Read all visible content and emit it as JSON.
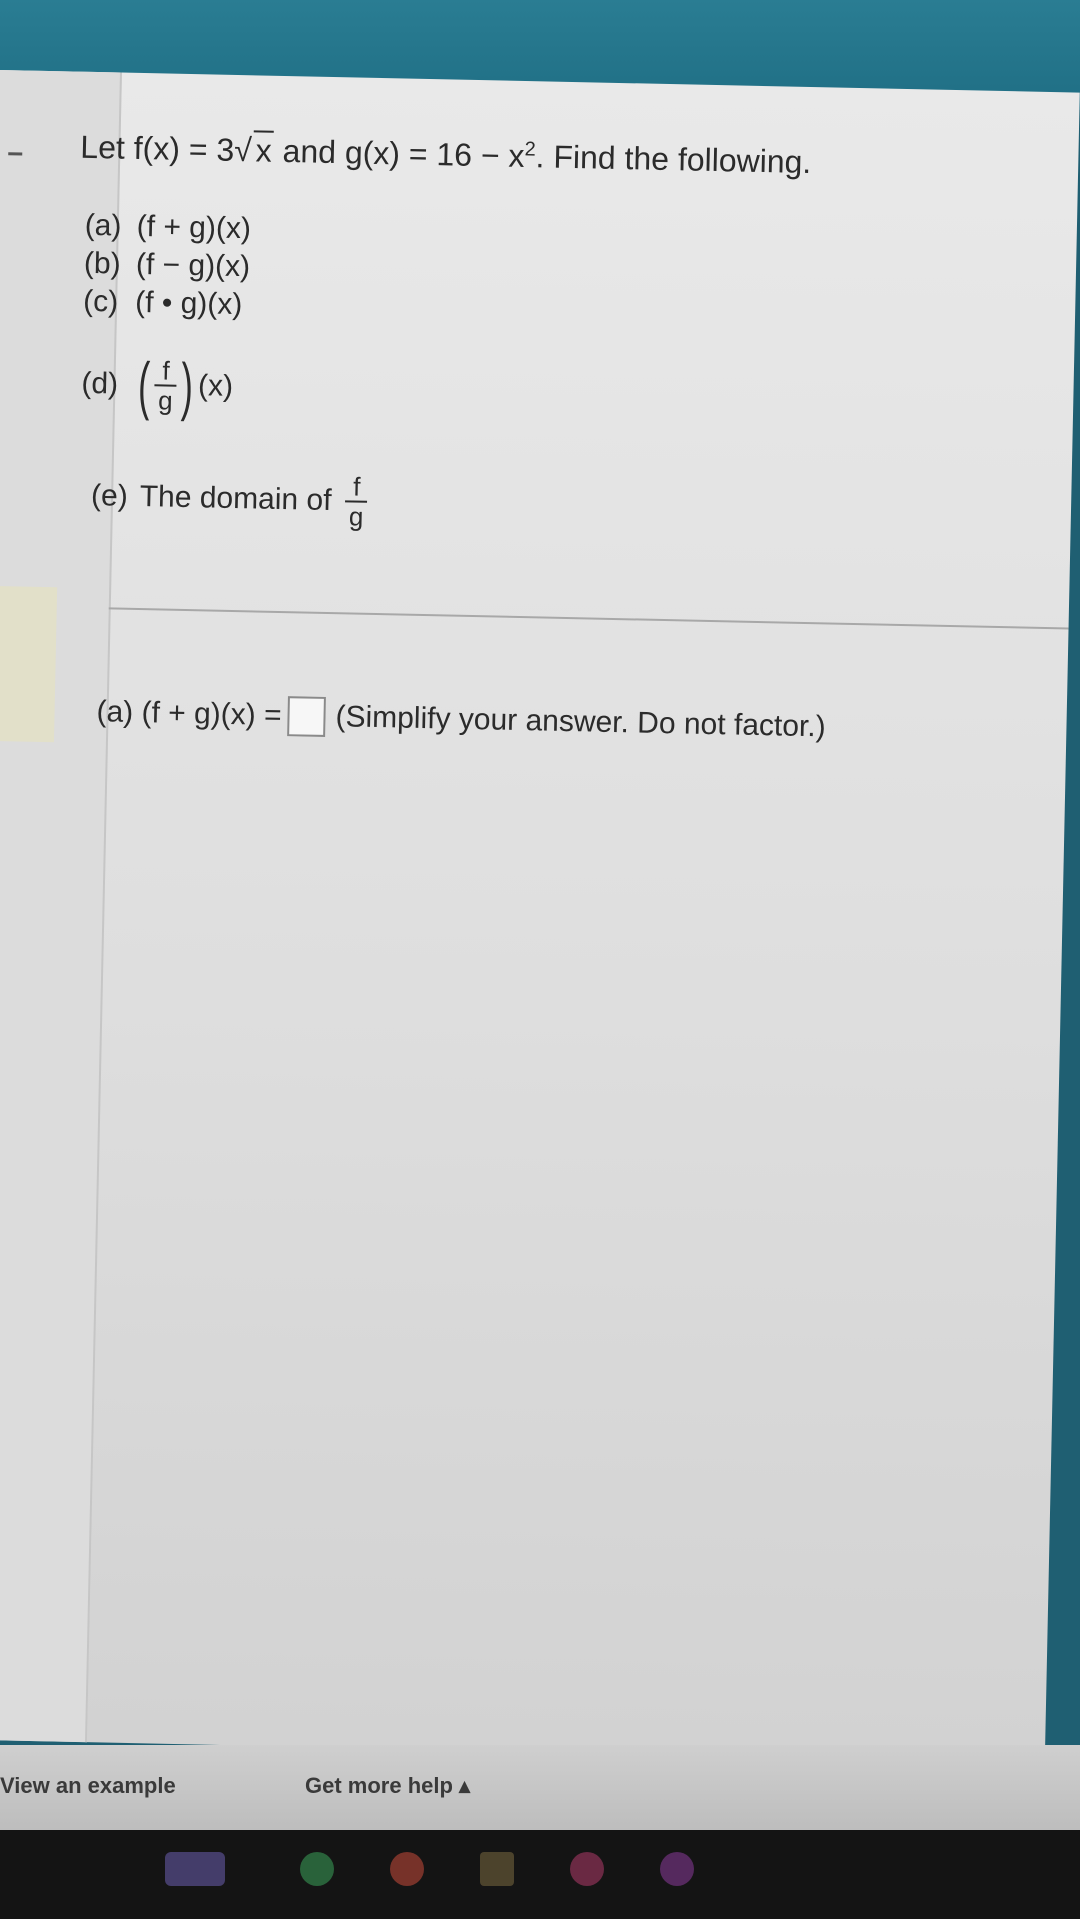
{
  "problem": {
    "stmt_prefix": "Let f(x) = 3",
    "sqrt_arg": "x",
    "stmt_mid": " and g(x) = 16 − x",
    "exponent": "2",
    "stmt_suffix": ". Find the following."
  },
  "parts": [
    {
      "label": "(a)",
      "expr": "(f + g)(x)"
    },
    {
      "label": "(b)",
      "expr": "(f − g)(x)"
    },
    {
      "label": "(c)",
      "expr": "(f • g)(x)"
    }
  ],
  "part_d": {
    "label": "(d)",
    "numerator": "f",
    "denominator": "g",
    "tail": "(x)"
  },
  "part_e": {
    "label": "(e)",
    "text": "The domain of",
    "numerator": "f",
    "denominator": "g"
  },
  "answer": {
    "prefix": "(a) (f + g)(x) =",
    "value": "",
    "hint": "(Simplify your answer. Do not factor.)"
  },
  "footer": {
    "view_example": "View an example",
    "get_more_help": "Get more help ▴"
  },
  "colors": {
    "header": "#2a7d93",
    "page": "#e4e4e4",
    "taskbar": "#141414"
  }
}
